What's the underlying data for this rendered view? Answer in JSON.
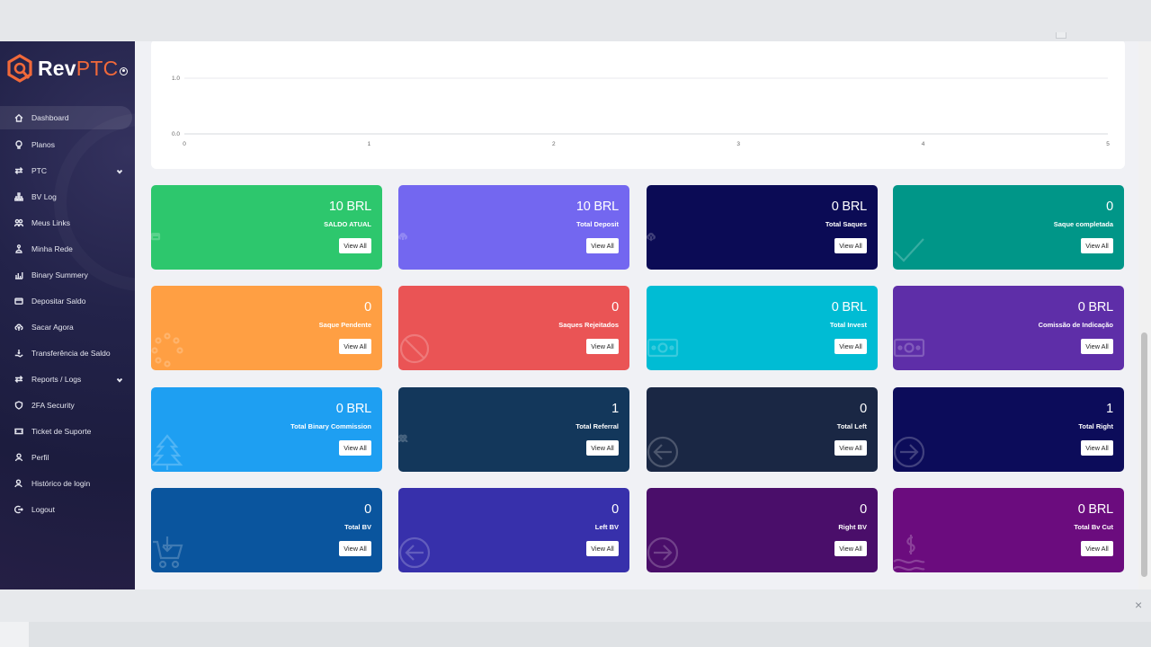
{
  "brand": {
    "name_main": "Rev",
    "name_accent": "PTC"
  },
  "nav": [
    {
      "label": "Dashboard",
      "icon": "home-icon",
      "active": true
    },
    {
      "label": "Planos",
      "icon": "lightbulb-icon"
    },
    {
      "label": "PTC",
      "icon": "exchange-icon",
      "dropdown": true
    },
    {
      "label": "BV Log",
      "icon": "sitemap-icon"
    },
    {
      "label": "Meus Links",
      "icon": "users-icon"
    },
    {
      "label": "Minha Rede",
      "icon": "network-icon"
    },
    {
      "label": "Binary Summery",
      "icon": "chart-icon"
    },
    {
      "label": "Depositar Saldo",
      "icon": "wallet-icon"
    },
    {
      "label": "Sacar Agora",
      "icon": "cloud-upload-icon"
    },
    {
      "label": "Transferência de Saldo",
      "icon": "hand-money-icon"
    },
    {
      "label": "Reports / Logs",
      "icon": "exchange-icon",
      "dropdown": true
    },
    {
      "label": "2FA Security",
      "icon": "shield-icon"
    },
    {
      "label": "Ticket de Suporte",
      "icon": "ticket-icon"
    },
    {
      "label": "Perfil",
      "icon": "user-icon"
    },
    {
      "label": "Histórico de login",
      "icon": "user-history-icon"
    },
    {
      "label": "Logout",
      "icon": "logout-icon"
    }
  ],
  "chart_data": {
    "type": "line",
    "x": [
      0,
      1,
      2,
      3,
      4,
      5
    ],
    "series": [],
    "y_ticks": [
      "1.0",
      "0.0"
    ],
    "x_ticks": [
      "0",
      "1",
      "2",
      "3",
      "4",
      "5"
    ],
    "ylim": [
      0,
      1
    ],
    "xlim": [
      0,
      5
    ],
    "grid": true
  },
  "cards": [
    {
      "value": "10 BRL",
      "label": "SALDO ATUAL",
      "button": "View All",
      "color": "#2dc76d",
      "icon": "wallet-icon"
    },
    {
      "value": "10 BRL",
      "label": "Total Deposit",
      "button": "View All",
      "color": "#7367f0",
      "icon": "cloud-upload-icon"
    },
    {
      "value": "0 BRL",
      "label": "Total Saques",
      "button": "View All",
      "color": "#0b0b55",
      "icon": "cloud-download-icon"
    },
    {
      "value": "0",
      "label": "Saque completada",
      "button": "View All",
      "color": "#009688",
      "icon": "check-icon"
    },
    {
      "value": "0",
      "label": "Saque Pendente",
      "button": "View All",
      "color": "#ff9f43",
      "icon": "spinner-icon"
    },
    {
      "value": "0",
      "label": "Saques Rejeitados",
      "button": "View All",
      "color": "#ea5455",
      "icon": "ban-icon"
    },
    {
      "value": "0 BRL",
      "label": "Total Invest",
      "button": "View All",
      "color": "#00bcd4",
      "icon": "money-icon"
    },
    {
      "value": "0 BRL",
      "label": "Comissão de Indicação",
      "button": "View All",
      "color": "#5e2ea8",
      "icon": "money-icon"
    },
    {
      "value": "0 BRL",
      "label": "Total Binary Commission",
      "button": "View All",
      "color": "#1e9ff2",
      "icon": "tree-icon"
    },
    {
      "value": "1",
      "label": "Total Referral",
      "button": "View All",
      "color": "#13375b",
      "icon": "users-icon"
    },
    {
      "value": "0",
      "label": "Total Left",
      "button": "View All",
      "color": "#1a2744",
      "icon": "arrow-left-circle-icon"
    },
    {
      "value": "1",
      "label": "Total Right",
      "button": "View All",
      "color": "#0c0c5a",
      "icon": "arrow-right-circle-icon"
    },
    {
      "value": "0",
      "label": "Total BV",
      "button": "View All",
      "color": "#0a559e",
      "icon": "cart-icon"
    },
    {
      "value": "0",
      "label": "Left BV",
      "button": "View All",
      "color": "#3730ab",
      "icon": "arrow-left-circle-icon"
    },
    {
      "value": "0",
      "label": "Right BV",
      "button": "View All",
      "color": "#4a0e6a",
      "icon": "arrow-right-circle-icon"
    },
    {
      "value": "0 BRL",
      "label": "Total Bv Cut",
      "button": "View All",
      "color": "#6b0c7e",
      "icon": "dollar-hand-icon"
    }
  ]
}
